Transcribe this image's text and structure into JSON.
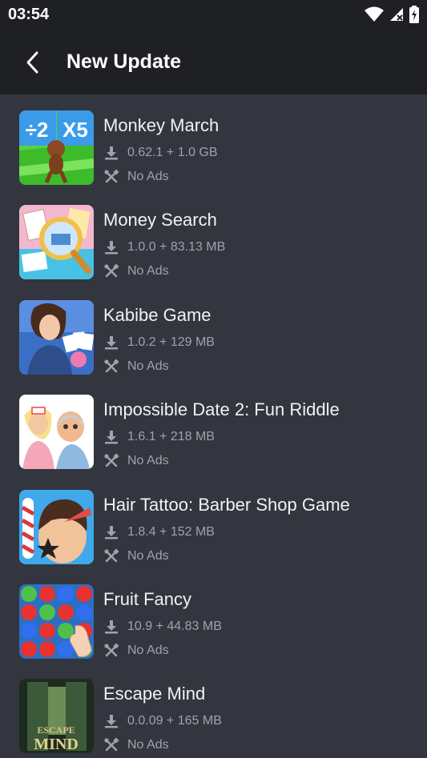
{
  "status_bar": {
    "time": "03:54"
  },
  "header": {
    "title": "New Update"
  },
  "apps": [
    {
      "name": "Monkey March",
      "version_size": "0.62.1 + 1.0 GB",
      "feature": "No Ads"
    },
    {
      "name": "Money Search",
      "version_size": "1.0.0 + 83.13 MB",
      "feature": "No Ads"
    },
    {
      "name": "Kabibe Game",
      "version_size": "1.0.2 + 129 MB",
      "feature": "No Ads"
    },
    {
      "name": "Impossible Date 2: Fun Riddle",
      "version_size": "1.6.1 + 218 MB",
      "feature": "No Ads"
    },
    {
      "name": "Hair Tattoo: Barber Shop Game",
      "version_size": "1.8.4 + 152 MB",
      "feature": "No Ads"
    },
    {
      "name": "Fruit Fancy",
      "version_size": "10.9 + 44.83 MB",
      "feature": "No Ads"
    },
    {
      "name": "Escape Mind",
      "version_size": "0.0.09 + 165 MB",
      "feature": "No Ads"
    }
  ],
  "icon_art": {
    "monkey_march": {
      "left_text": "÷2",
      "right_text": "X5"
    },
    "escape_mind": {
      "line1": "ESCAPE",
      "line2": "MIND"
    }
  }
}
